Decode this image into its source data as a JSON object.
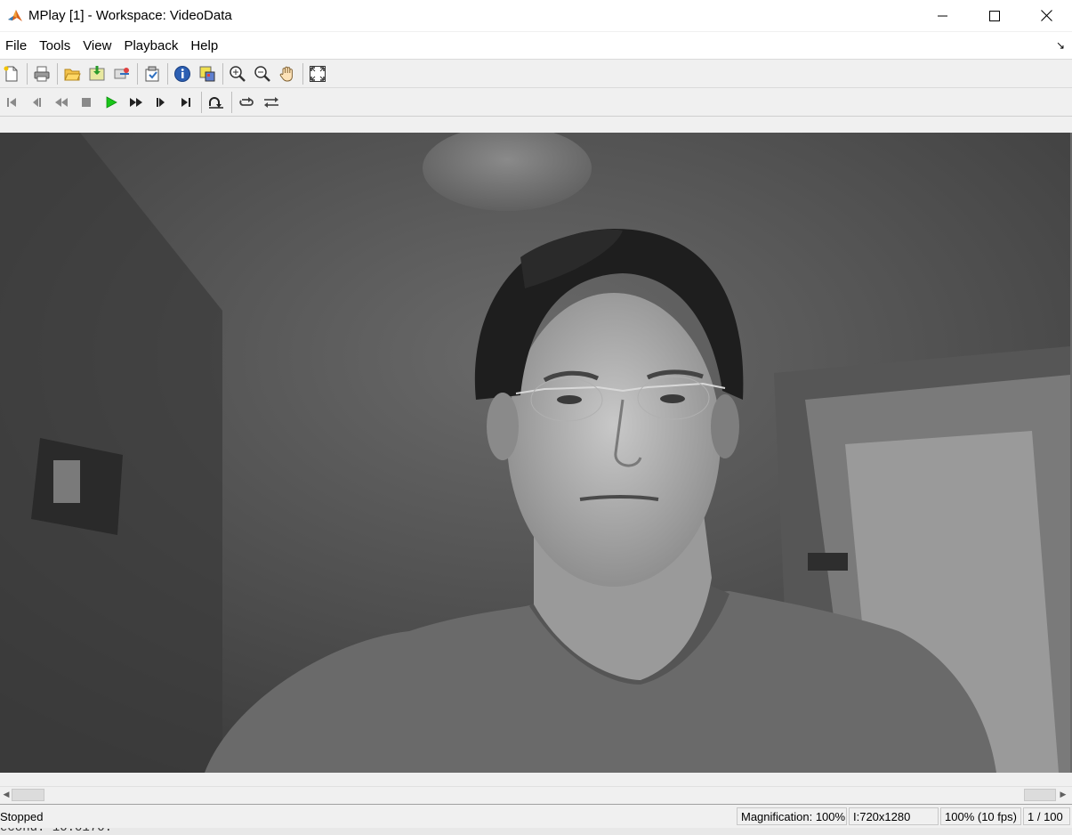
{
  "window": {
    "title": "MPlay [1] - Workspace: VideoData",
    "controls": [
      "minimize-icon",
      "maximize-icon",
      "close-icon"
    ]
  },
  "menu": {
    "items": [
      "File",
      "Tools",
      "View",
      "Playback",
      "Help"
    ]
  },
  "toolbar1": {
    "buttons": [
      "new-icon",
      "print-icon",
      "open-icon",
      "import-icon",
      "connect-icon",
      "export-icon",
      "info-icon",
      "colormap-icon",
      "zoom-in-icon",
      "zoom-out-icon",
      "pan-hand-icon",
      "fit-to-window-icon"
    ]
  },
  "toolbar2": {
    "buttons": [
      "go-first-icon",
      "step-back-icon",
      "rewind-icon",
      "stop-icon",
      "play-icon",
      "fast-forward-icon",
      "step-forward-icon",
      "go-last-icon",
      "jump-to-icon",
      "loop-icon",
      "autoreverse-icon"
    ],
    "play_color": "#19c619"
  },
  "status": {
    "state": "Stopped",
    "magnification": "Magnification: 100%",
    "image_size": "I:720x1280",
    "playback_rate": "100% (10 fps)",
    "frame": "1 / 100"
  },
  "background_text": "econd: 10.0170."
}
